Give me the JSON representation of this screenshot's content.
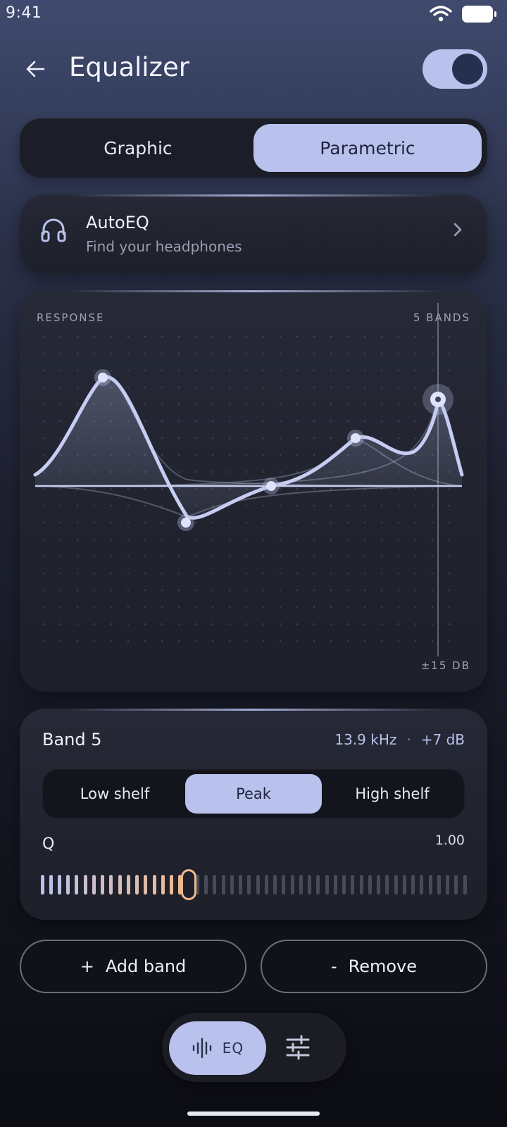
{
  "status_bar": {
    "time": "9:41"
  },
  "header": {
    "title": "Equalizer",
    "enabled": true
  },
  "modes": {
    "options": [
      "Graphic",
      "Parametric"
    ],
    "selected": "Parametric"
  },
  "autoeq": {
    "title": "AutoEQ",
    "subtitle": "Find your headphones"
  },
  "response": {
    "label": "RESPONSE",
    "bands_label": "5 BANDS",
    "range_label": "±15 DB",
    "band_count": 5,
    "selected_band": 5
  },
  "band_panel": {
    "title": "Band 5",
    "frequency": "13.9 kHz",
    "separator": "·",
    "gain": "+7 dB",
    "filter_types": [
      "Low shelf",
      "Peak",
      "High shelf"
    ],
    "selected_filter": "Peak",
    "q_label": "Q",
    "q_value": "1.00",
    "q_fraction": 0.34
  },
  "actions": {
    "add_label": "Add band",
    "add_icon": "+",
    "remove_label": "Remove",
    "remove_icon": "-"
  },
  "bottom_nav": {
    "eq_label": "EQ",
    "active": "EQ"
  },
  "colors": {
    "accent": "#b9c2ec",
    "slider_active": "#f0b98a"
  }
}
